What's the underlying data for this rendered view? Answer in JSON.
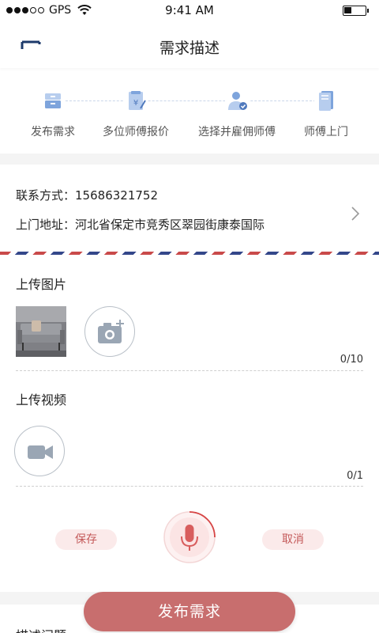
{
  "status_bar": {
    "carrier": "GPS",
    "time": "9:41 AM"
  },
  "nav": {
    "title": "需求描述",
    "back_icon": "back-arrow-icon"
  },
  "steps": [
    {
      "label": "发布需求",
      "icon": "drawer-icon"
    },
    {
      "label": "多位师傅报价",
      "icon": "quote-document-icon"
    },
    {
      "label": "选择并雇佣师傅",
      "icon": "worker-icon"
    },
    {
      "label": "师傅上门",
      "icon": "book-icon"
    }
  ],
  "contact": {
    "phone_label": "联系方式：",
    "phone_value": "15686321752",
    "address_label": "上门地址：",
    "address_value": "河北省保定市竞秀区翠园街康泰国际"
  },
  "upload_images": {
    "title": "上传图片",
    "count": "0/10"
  },
  "upload_video": {
    "title": "上传视频",
    "count": "0/1"
  },
  "voice": {
    "save_label": "保存",
    "cancel_label": "取消",
    "progress": 0.25
  },
  "description": {
    "title": "描述问题"
  },
  "publish_button": {
    "label": "发布需求"
  },
  "colors": {
    "accent": "#c86e6e",
    "icon_blue": "#8fb1e0",
    "pill_bg": "#fbeaea"
  }
}
